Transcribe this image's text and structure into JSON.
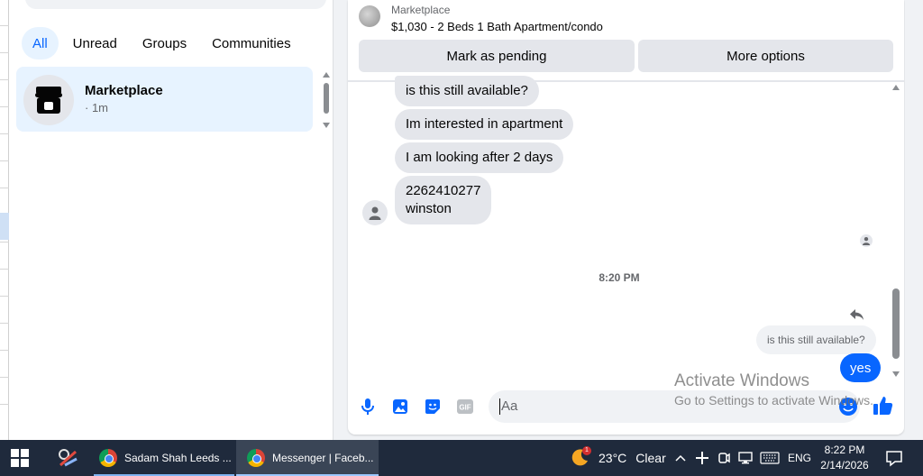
{
  "colors": {
    "accent": "#0866ff",
    "active_bg": "#e7f3ff",
    "bubble_in": "#e4e6eb",
    "taskbar": "#1f2a3c"
  },
  "left_panel": {
    "filters": [
      {
        "label": "All",
        "active": true
      },
      {
        "label": "Unread",
        "active": false
      },
      {
        "label": "Groups",
        "active": false
      },
      {
        "label": "Communities",
        "active": false
      }
    ],
    "conversation": {
      "name": "Marketplace",
      "meta": "· 1m",
      "avatar_icon": "storefront-icon"
    }
  },
  "chat": {
    "listing": {
      "category": "Marketplace",
      "title": "$1,030 - 2 Beds 1 Bath Apartment/condo"
    },
    "actions": {
      "pending_label": "Mark as pending",
      "more_label": "More options"
    },
    "incoming": [
      {
        "text": "is this still available?"
      },
      {
        "text": "Im interested in apartment"
      },
      {
        "text": "I am looking after 2 days"
      },
      {
        "line1": "2262410277",
        "line2": "winston"
      }
    ],
    "time_separator": "8:20 PM",
    "reply_quote": "is this still available?",
    "outgoing": "yes",
    "composer": {
      "placeholder": "Aa",
      "icons": [
        "microphone-icon",
        "image-icon",
        "sticker-icon",
        "gif-icon",
        "emoji-icon",
        "like-icon"
      ],
      "gif_label": "GIF"
    }
  },
  "watermark": {
    "title": "Activate Windows",
    "subtitle": "Go to Settings to activate Windows."
  },
  "taskbar": {
    "apps": [
      {
        "label": "Sadam Shah Leeds ..."
      },
      {
        "label": "Messenger | Faceb..."
      }
    ],
    "weather": {
      "temp": "23°C",
      "condition": "Clear",
      "badge": "1"
    },
    "language": "ENG",
    "time": "8:22 PM",
    "date": "2/14/2026"
  }
}
